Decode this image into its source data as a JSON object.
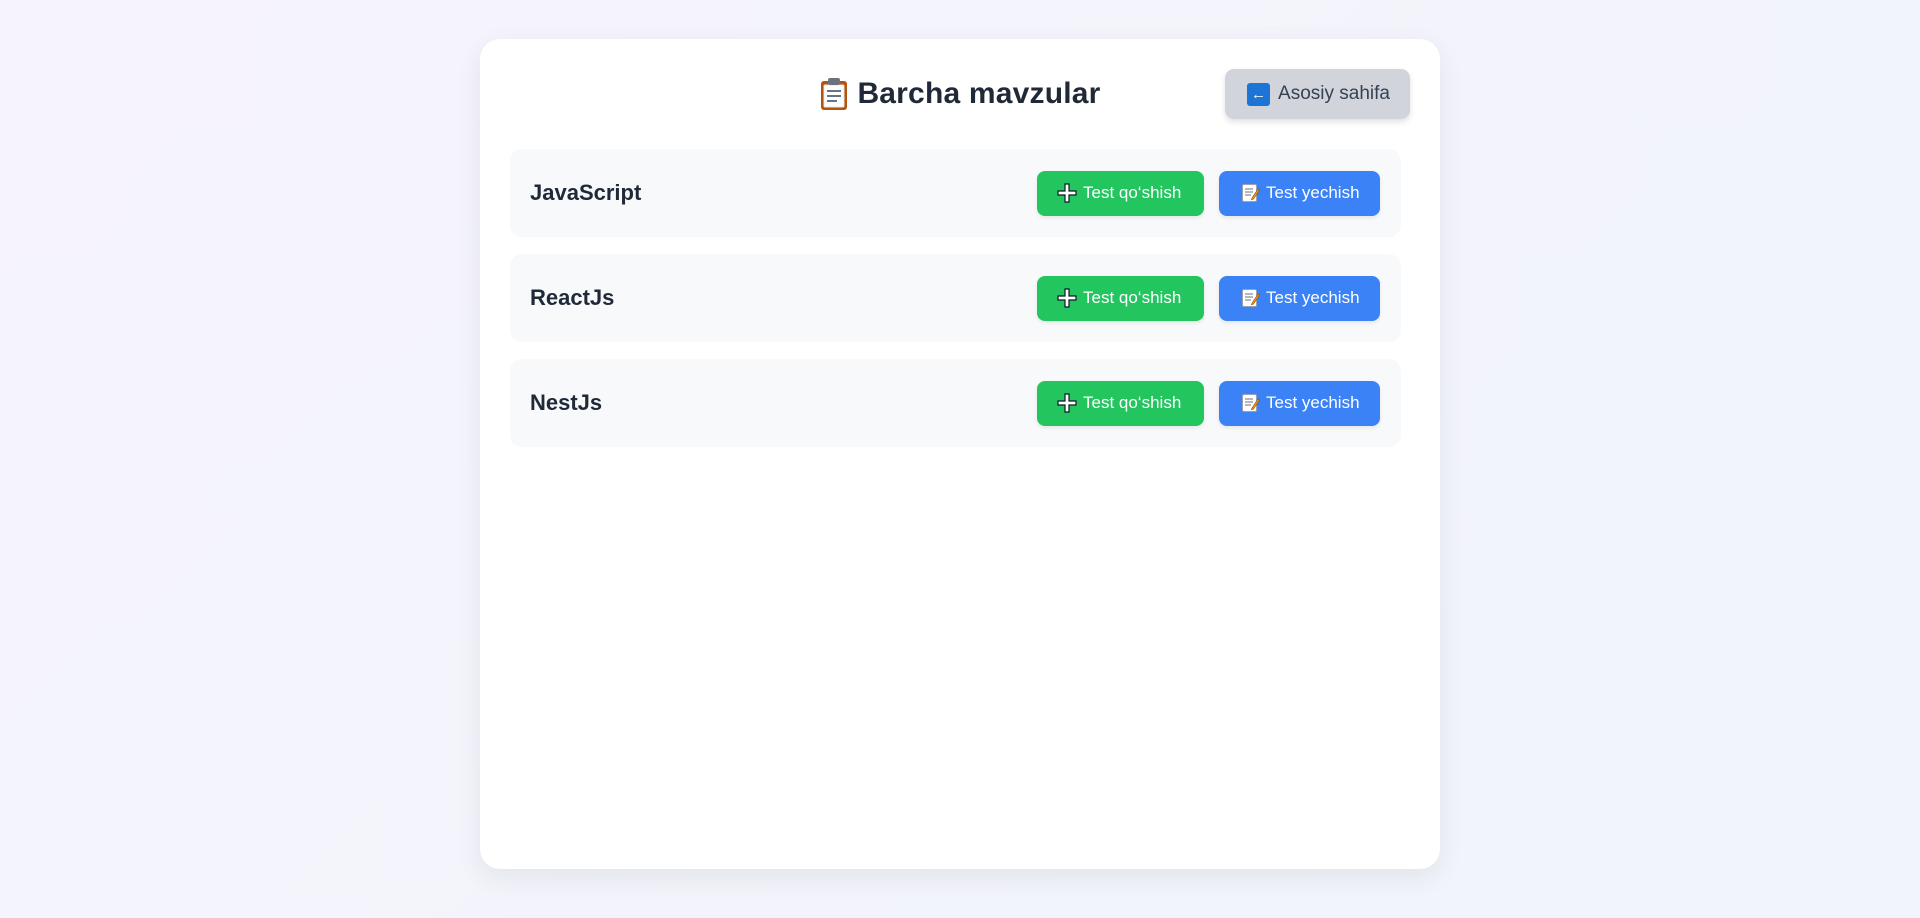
{
  "header": {
    "title": "Barcha mavzular",
    "title_icon": "clipboard-icon",
    "home_button_label": "Asosiy sahifa",
    "home_button_icon": "back-arrow-icon"
  },
  "topics": [
    {
      "name": "JavaScript",
      "add_label": "Test qo‘shish",
      "solve_label": "Test yechish"
    },
    {
      "name": "ReactJs",
      "add_label": "Test qo‘shish",
      "solve_label": "Test yechish"
    },
    {
      "name": "NestJs",
      "add_label": "Test qo‘shish",
      "solve_label": "Test yechish"
    }
  ],
  "icons": {
    "add": "plus-icon",
    "solve": "memo-icon"
  },
  "colors": {
    "add_button": "#22c55e",
    "solve_button": "#3b82f6",
    "home_button": "#d1d5db",
    "title_text": "#1f2937"
  }
}
